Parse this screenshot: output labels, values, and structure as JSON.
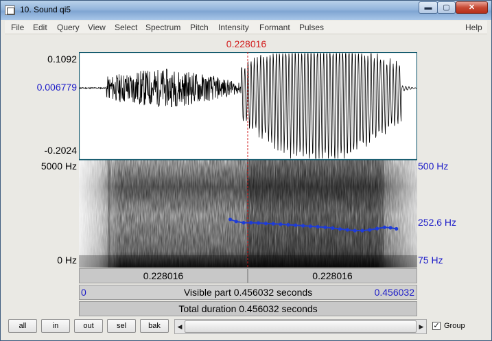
{
  "window": {
    "title": "10. Sound qi5",
    "min_glyph": "▬",
    "max_glyph": "▢",
    "close_glyph": "✕"
  },
  "menu": [
    "File",
    "Edit",
    "Query",
    "View",
    "Select",
    "Spectrum",
    "Pitch",
    "Intensity",
    "Formant",
    "Pulses"
  ],
  "help": "Help",
  "cursor": {
    "time_label": "0.228016",
    "time": 0.228016
  },
  "waveform": {
    "max_label": "0.1092",
    "mid_label": "0.006779",
    "min_label": "-0.2024",
    "ymax": 0.1092,
    "ymin": -0.2024,
    "value_at_cursor": 0.006779
  },
  "spectrogram": {
    "top_label": "5000 Hz",
    "bottom_label": "0 Hz",
    "fmax": 5000,
    "fmin": 0
  },
  "pitch": {
    "top_label": "500 Hz",
    "mid_label": "252.6 Hz",
    "bottom_label": "75 Hz",
    "fmax": 500,
    "fmin": 75,
    "value_at_cursor": 252.6,
    "color": "#1f3cd6",
    "track": [
      [
        0.204,
        265
      ],
      [
        0.212,
        257
      ],
      [
        0.222,
        252
      ],
      [
        0.232,
        252
      ],
      [
        0.242,
        251
      ],
      [
        0.252,
        249
      ],
      [
        0.262,
        248
      ],
      [
        0.272,
        246
      ],
      [
        0.282,
        244
      ],
      [
        0.292,
        242
      ],
      [
        0.302,
        240
      ],
      [
        0.312,
        238
      ],
      [
        0.322,
        236
      ],
      [
        0.332,
        234
      ],
      [
        0.342,
        231
      ],
      [
        0.352,
        227
      ],
      [
        0.362,
        224
      ],
      [
        0.372,
        221
      ],
      [
        0.382,
        221
      ],
      [
        0.392,
        224
      ],
      [
        0.402,
        229
      ],
      [
        0.412,
        234
      ],
      [
        0.42,
        232
      ],
      [
        0.428,
        228
      ]
    ]
  },
  "axes": {
    "left_segment": "0.228016",
    "right_segment": "0.228016",
    "visible_start": "0",
    "visible_text": "Visible part 0.456032 seconds",
    "visible_end": "0.456032",
    "total_text": "Total duration 0.456032 seconds",
    "tmin": 0,
    "tmax": 0.456032
  },
  "toolbar": {
    "all": "all",
    "in": "in",
    "out": "out",
    "sel": "sel",
    "bak": "bak",
    "group_label": "Group",
    "group_checked": "✓"
  },
  "colors": {
    "cursor": "#d21c1c",
    "axis_blue": "#1c1cc8",
    "frame": "#145a6e"
  }
}
